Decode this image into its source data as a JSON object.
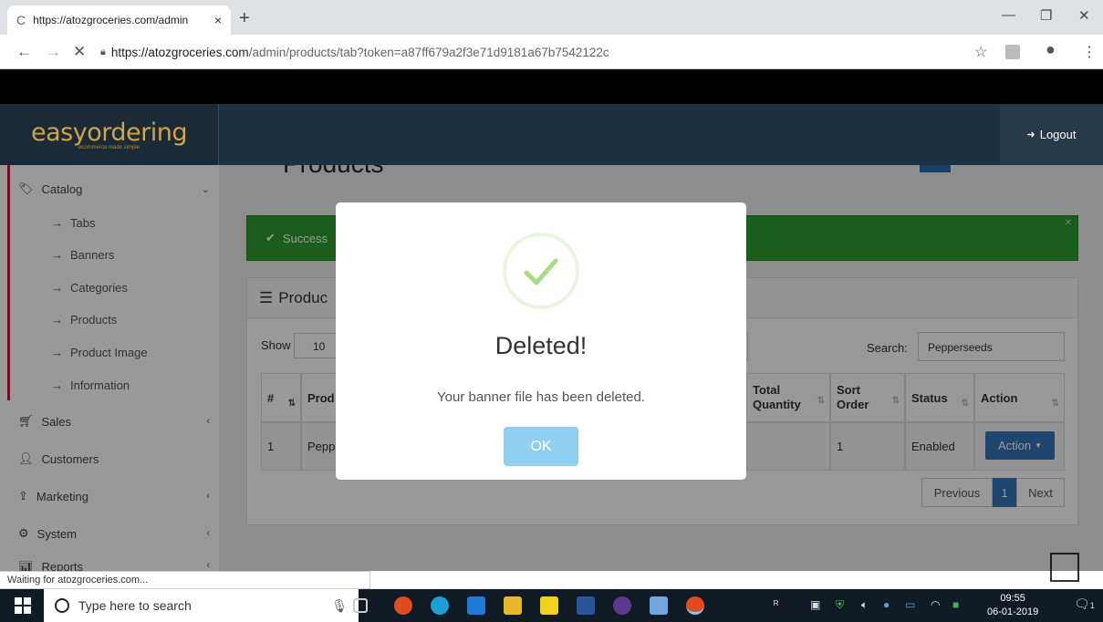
{
  "browser": {
    "tab_title": "https://atozgroceries.com/admin",
    "tab_close": "×",
    "new_tab": "+",
    "url_host": "https://atozgroceries.com",
    "url_path": "/admin/products/tab?token=a87ff679a2f3e71d9181a67b7542122c",
    "status_text": "Waiting for atozgroceries.com..."
  },
  "header": {
    "logo_text": "easyordering",
    "logo_tagline": "ecommerce made simple",
    "logout_label": "Logout"
  },
  "sidebar": {
    "catalog": "Catalog",
    "catalog_items": [
      "Tabs",
      "Banners",
      "Categories",
      "Products",
      "Product Image",
      "Information"
    ],
    "sales": "Sales",
    "customers": "Customers",
    "marketing": "Marketing",
    "system": "System",
    "reports": "Reports"
  },
  "page": {
    "title": "Products",
    "alert_text": "Success",
    "panel_title": "Produc",
    "show_label": "Show",
    "show_value": "10",
    "search_label": "Search:",
    "search_value": "Pepperseeds",
    "columns": {
      "num": "#",
      "product": "Prod",
      "total_qty_1": "Total",
      "total_qty_2": "Quantity",
      "sort_1": "Sort",
      "sort_2": "Order",
      "status": "Status",
      "action": "Action"
    },
    "row": {
      "num": "1",
      "product": "Pepp",
      "sort": "1",
      "status": "Enabled",
      "action": "Action"
    },
    "pager": {
      "prev": "Previous",
      "current": "1",
      "next": "Next"
    }
  },
  "modal": {
    "title": "Deleted!",
    "message": "Your banner file has been deleted.",
    "ok": "OK",
    "check_color": "#a5dc86"
  },
  "taskbar": {
    "search_placeholder": "Type here to search",
    "time": "09:55",
    "date": "06-01-2019",
    "notification_count": "1"
  }
}
